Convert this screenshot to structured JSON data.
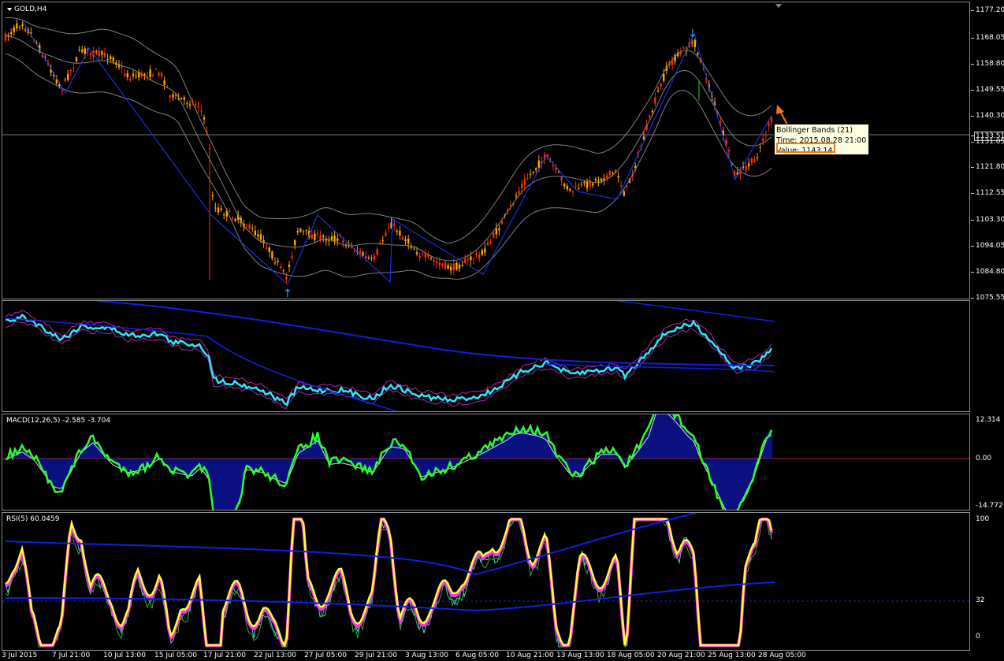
{
  "chart": {
    "symbol_label": "GOLD,H4",
    "price_ticks": [
      "1177.20",
      "1168.05",
      "1158.80",
      "1149.55",
      "1140.30",
      "1133.51",
      "1131.05",
      "1121.80",
      "1112.55",
      "1103.30",
      "1094.05",
      "1084.80",
      "1075.55"
    ],
    "current_price": "1133.51",
    "tooltip": {
      "line1": "Bollinger Bands (21)",
      "line2": "Time: 2015.08.28 21:00",
      "line3": "Value: 1143.14"
    }
  },
  "ma_pane": {
    "label": ""
  },
  "macd_pane": {
    "label": "MACD(12,26,5) -2.585 -3.704",
    "ticks": [
      "12.314",
      "0.00",
      "-14.772"
    ]
  },
  "rsi_pane": {
    "label": "RSI(5) 60.0459",
    "ticks": [
      "100",
      "32",
      "0"
    ]
  },
  "x_labels": [
    "3 Jul 2015",
    "7 Jul 21:00",
    "10 Jul 13:00",
    "15 Jul 05:00",
    "17 Jul 21:00",
    "22 Jul 13:00",
    "27 Jul 05:00",
    "29 Jul 21:00",
    "3 Aug 13:00",
    "6 Aug 05:00",
    "10 Aug 21:00",
    "13 Aug 13:00",
    "18 Aug 05:00",
    "20 Aug 21:00",
    "25 Aug 13:00",
    "28 Aug 05:00"
  ],
  "colors": {
    "bull": "#ffa500",
    "bear": "#ff2b00",
    "band": "#808080",
    "zigzag": "#1b3bff",
    "cyan": "#2ee8ff",
    "magenta": "#ff2dff",
    "yellow": "#ffff33",
    "green": "#2bff2b",
    "hist": "#1420ff",
    "accent": "#f07a1b"
  }
}
